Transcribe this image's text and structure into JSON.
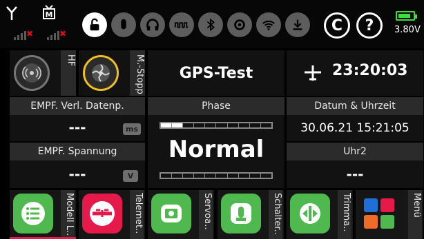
{
  "status": {
    "icons": [
      "antenna-icon",
      "receiver-icon",
      "lock-icon",
      "microphone-icon",
      "headphones-icon",
      "signal-wave-icon",
      "bluetooth-icon",
      "settings-target-icon",
      "wifi-icon",
      "download-icon",
      "refresh-icon",
      "help-icon",
      "battery-icon"
    ],
    "refresh_glyph": "C",
    "help_glyph": "?",
    "battery_voltage": "3.80V",
    "colors": {
      "battery": "#3be03b",
      "accent_ring": "#f0c020",
      "app_green": "#4fb84f",
      "app_red": "#e6194b"
    }
  },
  "controls": {
    "hf_label": "HF",
    "mstop_label": "M.-Stopp"
  },
  "model": {
    "name": "GPS-Test"
  },
  "clock": {
    "time": "23:20:03"
  },
  "receiver": {
    "loss_header": "EMPF. Verl. Datenp.",
    "loss_value": "---",
    "loss_unit": "ms",
    "voltage_header": "EMPF. Spannung",
    "voltage_value": "---",
    "voltage_unit": "V"
  },
  "phase": {
    "header": "Phase",
    "value": "Normal",
    "progress_fraction": 0.18
  },
  "datetime": {
    "header": "Datum & Uhrzeit",
    "value": "30.06.21 15:21:05"
  },
  "timer2": {
    "header": "Uhr2",
    "value": "---"
  },
  "apps": [
    {
      "label": "Modell L..",
      "icon": "list-icon"
    },
    {
      "label": "Telemet..",
      "icon": "telemetry-icon"
    },
    {
      "label": "Servoa..",
      "icon": "servo-icon"
    },
    {
      "label": "Schalter..",
      "icon": "switch-icon"
    },
    {
      "label": "Trimma..",
      "icon": "trim-icon"
    },
    {
      "label": "Menü",
      "icon": "menu-grid-icon"
    }
  ]
}
